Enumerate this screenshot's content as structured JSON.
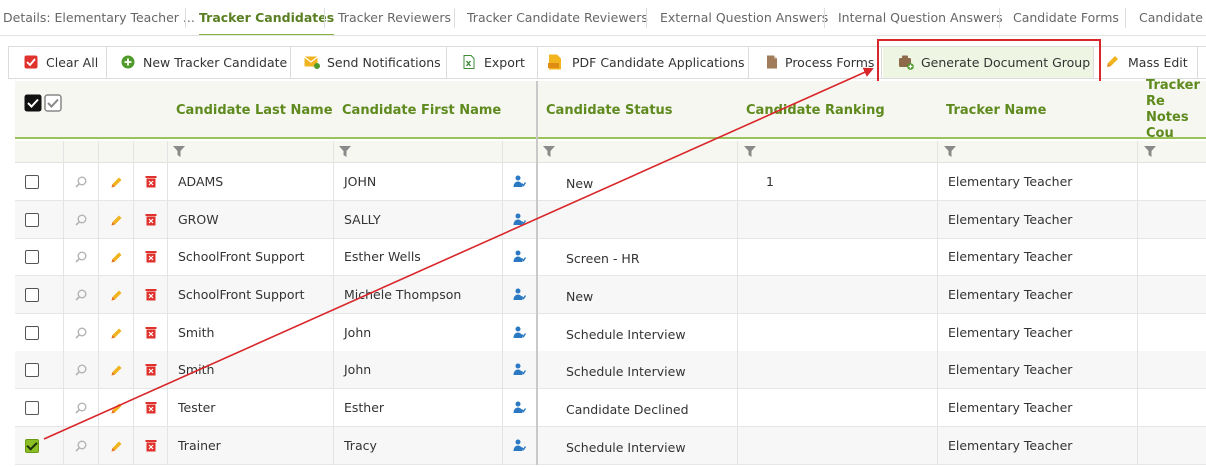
{
  "tabs": [
    {
      "label": "Details: Elementary Teacher ..."
    },
    {
      "label": "Tracker Candidates"
    },
    {
      "label": "Tracker Reviewers"
    },
    {
      "label": "Tracker Candidate Reviewers"
    },
    {
      "label": "External Question Answers"
    },
    {
      "label": "Internal Question Answers"
    },
    {
      "label": "Candidate Forms"
    },
    {
      "label": "Candidate F"
    }
  ],
  "toolbar": {
    "clear_all": "Clear All",
    "new_tracker_candidate": "New Tracker Candidate",
    "send_notifications": "Send Notifications",
    "export": "Export",
    "pdf_candidate_applications": "PDF Candidate Applications",
    "process_forms": "Process Forms",
    "generate_document_group": "Generate Document Group",
    "mass_edit": "Mass Edit"
  },
  "grid": {
    "columns": {
      "last_name": "Candidate Last Name",
      "first_name": "Candidate First Name",
      "status": "Candidate Status",
      "ranking": "Candidate Ranking",
      "tracker_name": "Tracker Name",
      "notes_line1": "Tracker Re",
      "notes_line2": "Notes Cou"
    },
    "rows": [
      {
        "last": "ADAMS",
        "first": "JOHN",
        "status": "New",
        "ranking": "1",
        "tracker": "Elementary Teacher",
        "checked": false
      },
      {
        "last": "GROW",
        "first": "SALLY",
        "status": "",
        "ranking": "",
        "tracker": "Elementary Teacher",
        "checked": false
      },
      {
        "last": "SchoolFront Support",
        "first": "Esther Wells",
        "status": "Screen - HR",
        "ranking": "",
        "tracker": "Elementary Teacher",
        "checked": false
      },
      {
        "last": "SchoolFront Support",
        "first": "Michele Thompson",
        "status": "New",
        "ranking": "",
        "tracker": "Elementary Teacher",
        "checked": false
      },
      {
        "last": "Smith",
        "first": "John",
        "status": "Schedule Interview",
        "ranking": "",
        "tracker": "Elementary Teacher",
        "checked": false
      },
      {
        "last": "Smith",
        "first": "John",
        "status": "Schedule Interview",
        "ranking": "",
        "tracker": "Elementary Teacher",
        "checked": false
      },
      {
        "last": "Tester",
        "first": "Esther",
        "status": "Candidate Declined",
        "ranking": "",
        "tracker": "Elementary Teacher",
        "checked": false
      },
      {
        "last": "Trainer",
        "first": "Tracy",
        "status": "Schedule Interview",
        "ranking": "",
        "tracker": "Elementary Teacher",
        "checked": true
      }
    ]
  },
  "colors": {
    "accent_green": "#8ab33f",
    "header_text": "#5e8a1e",
    "annotation_red": "#d9262a",
    "delete_icon": "#e0322c"
  }
}
